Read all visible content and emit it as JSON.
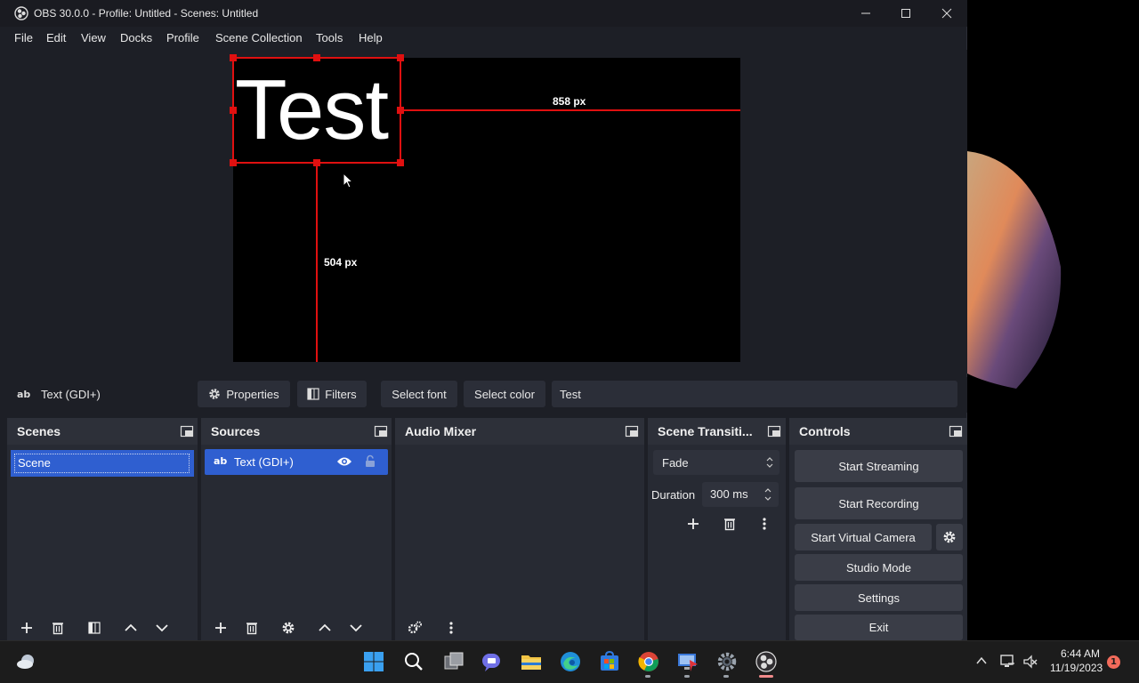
{
  "window": {
    "title": "OBS 30.0.0 - Profile: Untitled - Scenes: Untitled"
  },
  "menu": [
    "File",
    "Edit",
    "View",
    "Docks",
    "Profile",
    "Scene Collection",
    "Tools",
    "Help"
  ],
  "preview": {
    "source_text": "Test",
    "measure_right": "858 px",
    "measure_bottom": "504 px"
  },
  "context_bar": {
    "source_label": "Text (GDI+)",
    "properties": "Properties",
    "filters": "Filters",
    "select_font": "Select font",
    "select_color": "Select color",
    "text_value": "Test"
  },
  "scenes": {
    "title": "Scenes",
    "items": [
      "Scene"
    ]
  },
  "sources": {
    "title": "Sources",
    "items": [
      {
        "name": "Text (GDI+)",
        "visible": true,
        "locked": false
      }
    ]
  },
  "audio_mixer": {
    "title": "Audio Mixer"
  },
  "transitions": {
    "title": "Scene Transiti...",
    "selected": "Fade",
    "duration_label": "Duration",
    "duration_value": "300 ms"
  },
  "controls": {
    "title": "Controls",
    "start_streaming": "Start Streaming",
    "start_recording": "Start Recording",
    "start_virtual_camera": "Start Virtual Camera",
    "studio_mode": "Studio Mode",
    "settings": "Settings",
    "exit": "Exit"
  },
  "taskbar": {
    "time": "6:44 AM",
    "date": "11/19/2023",
    "notification_count": "1",
    "icons": [
      "weather-icon",
      "start-icon",
      "search-icon",
      "task-view-icon",
      "chat-icon",
      "file-explorer-icon",
      "edge-icon",
      "store-icon",
      "chrome-icon",
      "remote-desktop-icon",
      "settings-app-icon",
      "obs-icon"
    ]
  },
  "colors": {
    "accent": "#2f5fd0",
    "selection_red": "#e01010",
    "dock_bg": "#272a33",
    "window_bg": "#1d1f26"
  }
}
